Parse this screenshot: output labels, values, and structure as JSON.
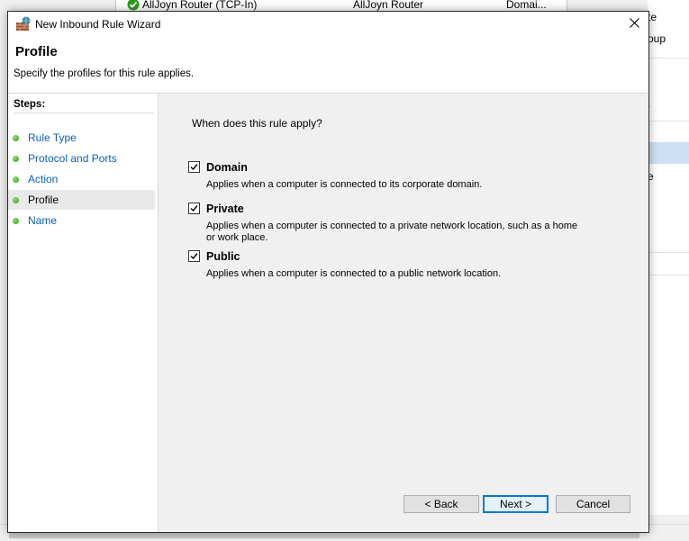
{
  "background": {
    "list_row": {
      "name": "AllJoyn Router (TCP-In)",
      "group": "AllJoyn Router",
      "profile": "Domai..."
    },
    "right_panel": {
      "text1": "te",
      "text2": "oup",
      "text3": ".",
      "text4": "e"
    }
  },
  "dialog": {
    "title": "New Inbound Rule Wizard",
    "header": {
      "title": "Profile",
      "description": "Specify the profiles for this rule applies."
    },
    "steps_label": "Steps:",
    "steps": [
      {
        "label": "Rule Type",
        "active": false
      },
      {
        "label": "Protocol and Ports",
        "active": false
      },
      {
        "label": "Action",
        "active": false
      },
      {
        "label": "Profile",
        "active": true
      },
      {
        "label": "Name",
        "active": false
      }
    ],
    "question": "When does this rule apply?",
    "options": [
      {
        "label": "Domain",
        "checked": true,
        "description": "Applies when a computer is connected to its corporate domain."
      },
      {
        "label": "Private",
        "checked": true,
        "description": "Applies when a computer is connected to a private network location, such as a home or work place."
      },
      {
        "label": "Public",
        "checked": true,
        "description": "Applies when a computer is connected to a public network location."
      }
    ],
    "buttons": {
      "back": "< Back",
      "next": "Next >",
      "cancel": "Cancel"
    }
  },
  "colors": {
    "link": "#0b5fb5",
    "accent": "#0078d7",
    "step_dot": "#2f9a1c"
  }
}
